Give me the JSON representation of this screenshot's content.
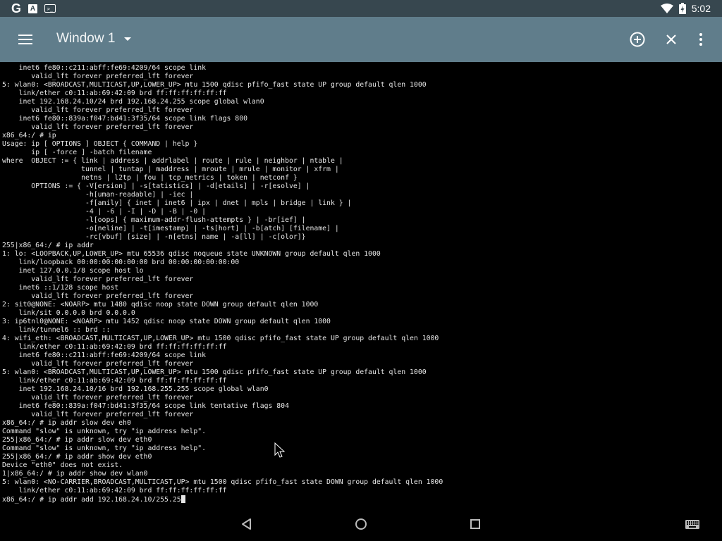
{
  "status_bar": {
    "google_icon": "G",
    "a_icon": "A",
    "terminal_icon": ">_",
    "time": "5:02",
    "wifi_icon": "wifi-full",
    "battery_icon": "battery-charging"
  },
  "app_bar": {
    "menu_icon": "hamburger-menu",
    "window_title": "Window 1",
    "dropdown_icon": "dropdown-arrow",
    "add_icon": "add-circle",
    "close_icon": "close",
    "more_icon": "more-vertical"
  },
  "terminal": {
    "lines": [
      "    inet6 fe80::c211:abff:fe69:4209/64 scope link",
      "       valid_lft forever preferred_lft forever",
      "5: wlan0: <BROADCAST,MULTICAST,UP,LOWER_UP> mtu 1500 qdisc pfifo_fast state UP group default qlen 1000",
      "    link/ether c0:11:ab:69:42:09 brd ff:ff:ff:ff:ff:ff",
      "    inet 192.168.24.10/24 brd 192.168.24.255 scope global wlan0",
      "       valid_lft forever preferred_lft forever",
      "    inet6 fe80::839a:f047:bd41:3f35/64 scope link flags 800",
      "       valid_lft forever preferred_lft forever",
      "x86_64:/ # ip",
      "Usage: ip [ OPTIONS ] OBJECT { COMMAND | help }",
      "       ip [ -force ] -batch filename",
      "where  OBJECT := { link | address | addrlabel | route | rule | neighbor | ntable |",
      "                   tunnel | tuntap | maddress | mroute | mrule | monitor | xfrm |",
      "                   netns | l2tp | fou | tcp_metrics | token | netconf }",
      "       OPTIONS := { -V[ersion] | -s[tatistics] | -d[etails] | -r[esolve] |",
      "                    -h[uman-readable] | -iec |",
      "                    -f[amily] { inet | inet6 | ipx | dnet | mpls | bridge | link } |",
      "                    -4 | -6 | -I | -D | -B | -0 |",
      "                    -l[oops] { maximum-addr-flush-attempts } | -br[ief] |",
      "                    -o[neline] | -t[imestamp] | -ts[hort] | -b[atch] [filename] |",
      "                    -rc[vbuf] [size] | -n[etns] name | -a[ll] | -c[olor]}",
      "255|x86_64:/ # ip addr",
      "1: lo: <LOOPBACK,UP,LOWER_UP> mtu 65536 qdisc noqueue state UNKNOWN group default qlen 1000",
      "    link/loopback 00:00:00:00:00:00 brd 00:00:00:00:00:00",
      "    inet 127.0.0.1/8 scope host lo",
      "       valid_lft forever preferred_lft forever",
      "    inet6 ::1/128 scope host",
      "       valid_lft forever preferred_lft forever",
      "2: sit0@NONE: <NOARP> mtu 1480 qdisc noop state DOWN group default qlen 1000",
      "    link/sit 0.0.0.0 brd 0.0.0.0",
      "3: ip6tnl0@NONE: <NOARP> mtu 1452 qdisc noop state DOWN group default qlen 1000",
      "    link/tunnel6 :: brd ::",
      "4: wifi_eth: <BROADCAST,MULTICAST,UP,LOWER_UP> mtu 1500 qdisc pfifo_fast state UP group default qlen 1000",
      "    link/ether c0:11:ab:69:42:09 brd ff:ff:ff:ff:ff:ff",
      "    inet6 fe80::c211:abff:fe69:4209/64 scope link",
      "       valid_lft forever preferred_lft forever",
      "5: wlan0: <BROADCAST,MULTICAST,UP,LOWER_UP> mtu 1500 qdisc pfifo_fast state UP group default qlen 1000",
      "    link/ether c0:11:ab:69:42:09 brd ff:ff:ff:ff:ff:ff",
      "    inet 192.168.24.10/16 brd 192.168.255.255 scope global wlan0",
      "       valid_lft forever preferred_lft forever",
      "    inet6 fe80::839a:f047:bd41:3f35/64 scope link tentative flags 804",
      "       valid_lft forever preferred_lft forever",
      "x86_64:/ # ip addr slow dev eh0",
      "Command \"slow\" is unknown, try \"ip address help\".",
      "255|x86_64:/ # ip addr slow dev eth0",
      "Command \"slow\" is unknown, try \"ip address help\".",
      "255|x86_64:/ # ip addr show dev eth0",
      "Device \"eth0\" does not exist.",
      "1|x86_64:/ # ip addr show dev wlan0",
      "5: wlan0: <NO-CARRIER,BROADCAST,MULTICAST,UP> mtu 1500 qdisc pfifo_fast state DOWN group default qlen 1000",
      "    link/ether c0:11:ab:69:42:09 brd ff:ff:ff:ff:ff:ff"
    ],
    "prompt_line": "x86_64:/ # ip addr add 192.168.24.10/255.25"
  },
  "nav_bar": {
    "back_icon": "back-triangle",
    "home_icon": "home-circle",
    "recents_icon": "recents-square",
    "keyboard_icon": "keyboard"
  },
  "colors": {
    "status_bar_bg": "#37474f",
    "app_bar_bg": "#607d8b",
    "terminal_bg": "#000000",
    "terminal_fg": "#e6e6e6"
  }
}
